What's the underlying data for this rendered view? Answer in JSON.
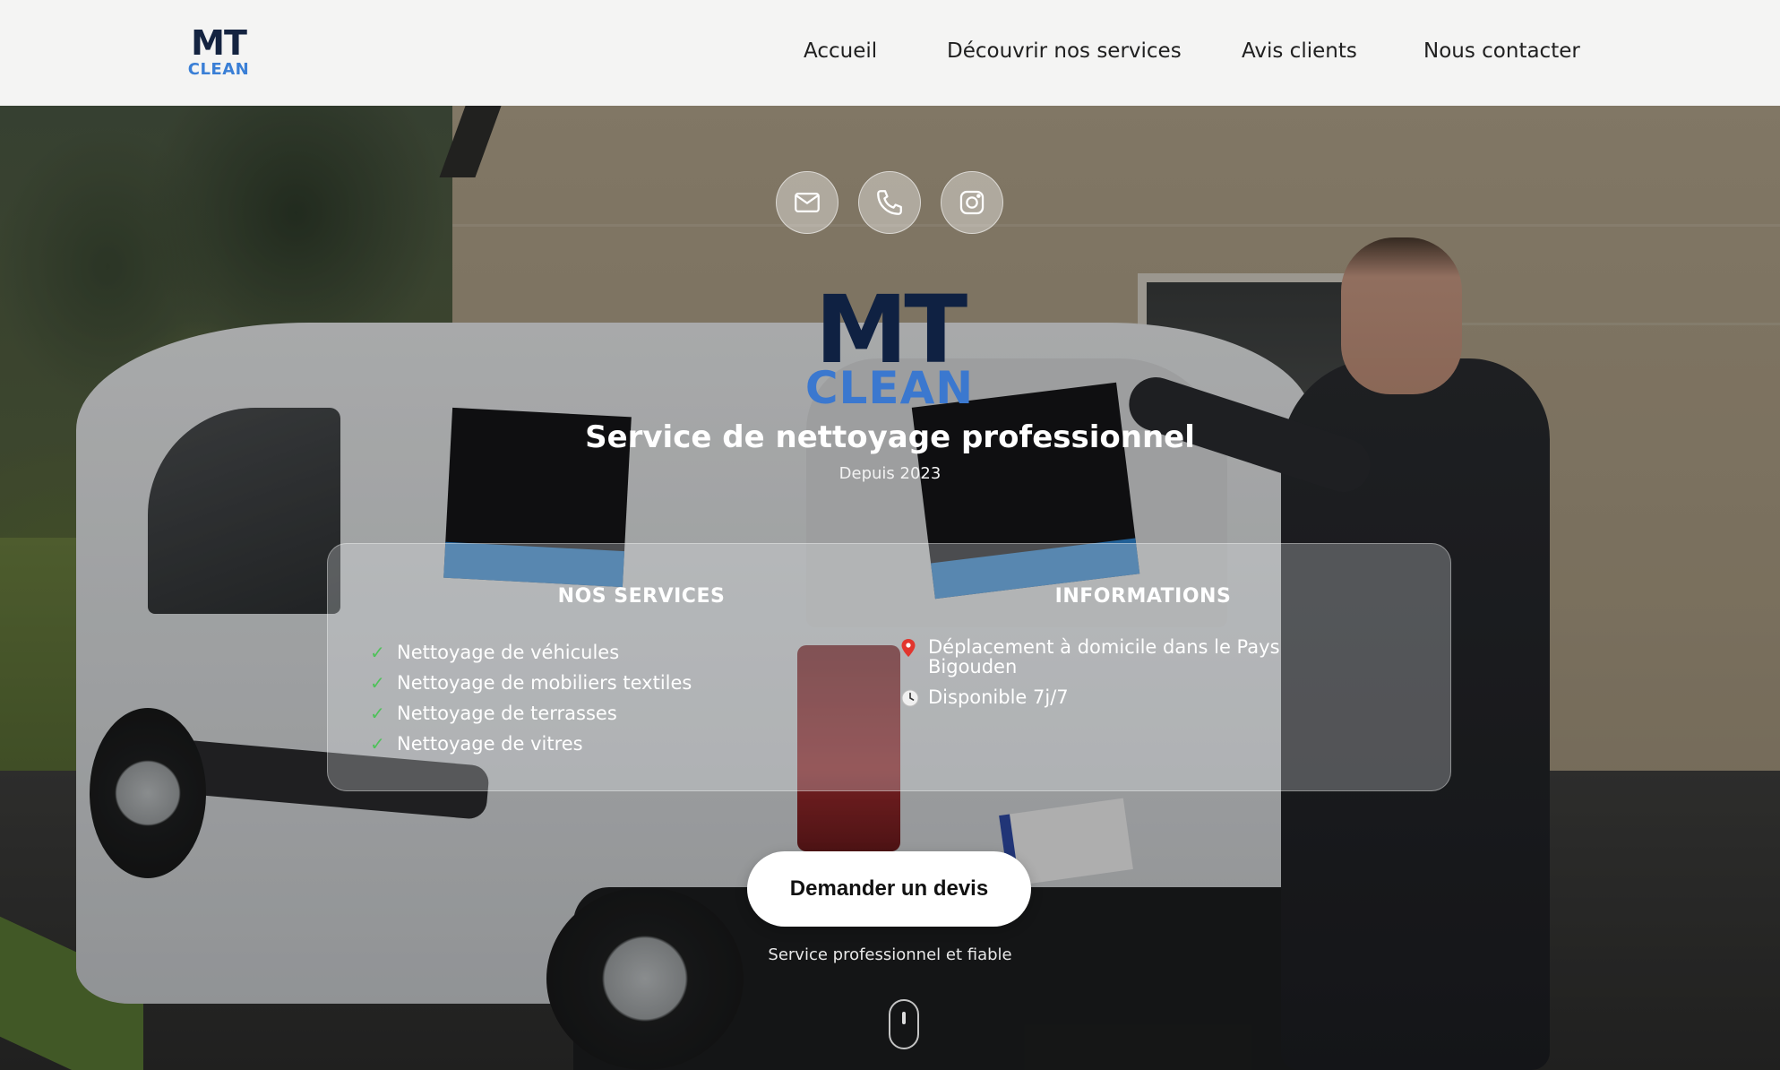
{
  "header": {
    "logo_top": "MT",
    "logo_bottom": "CLEAN",
    "nav": [
      {
        "label": "Accueil"
      },
      {
        "label": "Découvrir nos services"
      },
      {
        "label": "Avis clients"
      },
      {
        "label": "Nous contacter"
      }
    ]
  },
  "social": [
    {
      "icon": "mail-icon"
    },
    {
      "icon": "phone-icon"
    },
    {
      "icon": "instagram-icon"
    }
  ],
  "hero": {
    "logo_top": "MT",
    "logo_bottom": "CLEAN",
    "title": "Service de nettoyage professionnel",
    "subtitle": "Depuis 2023"
  },
  "panel": {
    "services_heading": "NOS SERVICES",
    "services": [
      "Nettoyage de véhicules",
      "Nettoyage de mobiliers textiles",
      "Nettoyage de terrasses",
      "Nettoyage de vitres"
    ],
    "info_heading": "INFORMATIONS",
    "info": [
      {
        "icon": "location-pin-icon",
        "text": "Déplacement à domicile dans le Pays Bigouden"
      },
      {
        "icon": "clock-icon",
        "text": "Disponible 7j/7"
      }
    ]
  },
  "cta": {
    "label": "Demander un devis",
    "caption": "Service professionnel et fiable"
  },
  "colors": {
    "brand_navy": "#142340",
    "brand_blue": "#3a7fd6",
    "check_green": "#4fc25a"
  }
}
